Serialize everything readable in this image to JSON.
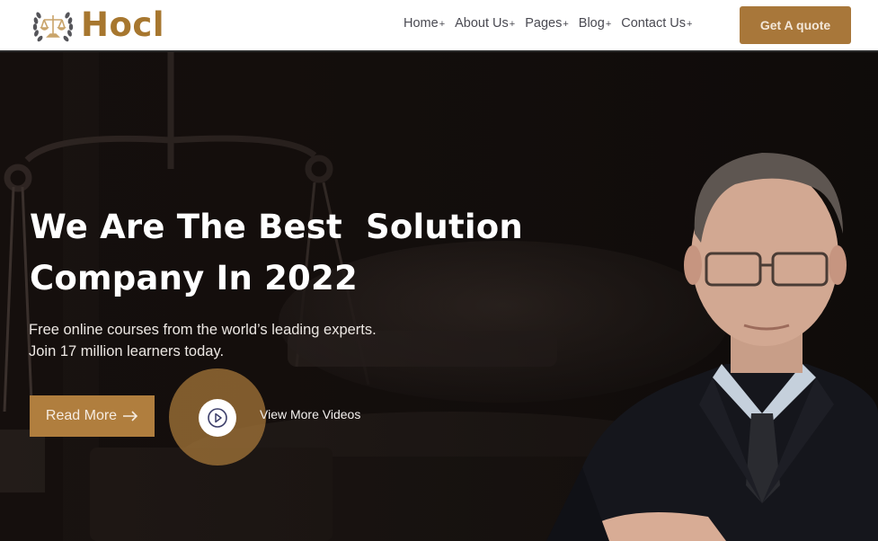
{
  "brand": {
    "name": "Hocl",
    "logo_icon": "scales-of-justice-laurel-icon",
    "accent_color": "#a8773a"
  },
  "nav": {
    "items": [
      {
        "label": "Home",
        "suffix": "+"
      },
      {
        "label": "About Us",
        "suffix": "+"
      },
      {
        "label": "Pages",
        "suffix": "+"
      },
      {
        "label": "Blog",
        "suffix": "+"
      },
      {
        "label": "Contact Us",
        "suffix": "+"
      }
    ],
    "cta_label": "Get A quote"
  },
  "hero": {
    "title_line1": "We Are The Best  Solution",
    "title_line2": "Company In 2022",
    "subtitle_line1": "Free online courses from the world’s leading experts.",
    "subtitle_line2": "Join 17 million learners today.",
    "read_more_label": "Read More",
    "read_more_icon": "arrow-right-icon",
    "video_icon": "play-icon",
    "video_label": "View More Videos",
    "background_description": "dark photo of scales of justice and gavel",
    "person_description": "man in dark suit with glasses, arms crossed"
  }
}
